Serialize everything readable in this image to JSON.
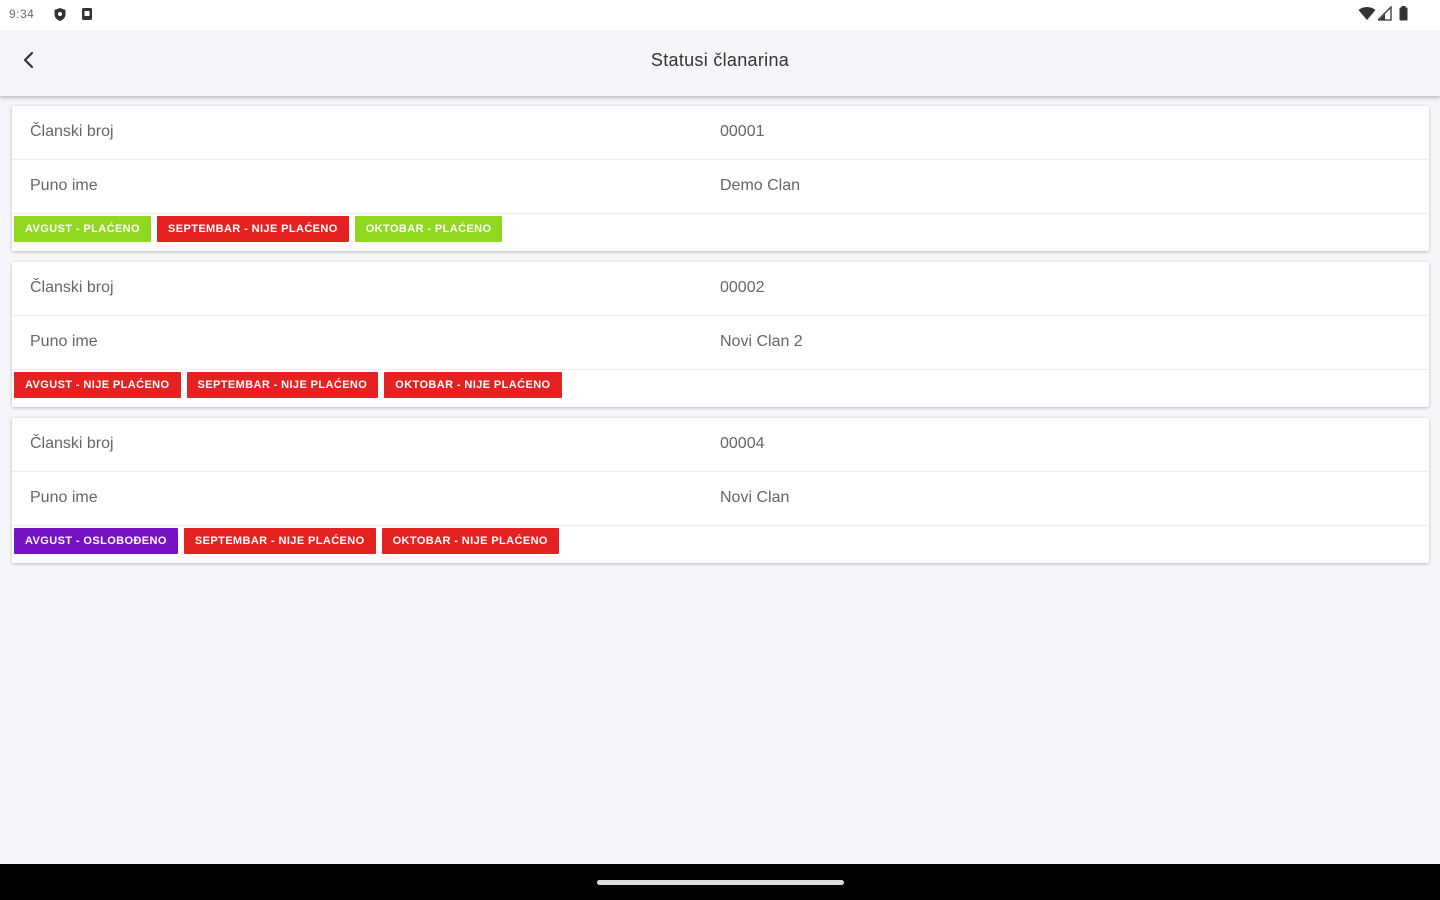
{
  "status_bar": {
    "time": "9:34"
  },
  "app_bar": {
    "title": "Statusi članarina"
  },
  "members": [
    {
      "number_label": "Članski broj",
      "number_value": "00001",
      "name_label": "Puno ime",
      "name_value": "Demo Clan",
      "statuses": [
        {
          "label": "AVGUST - PLAĆENO",
          "type": "paid"
        },
        {
          "label": "SEPTEMBAR - NIJE PLAĆENO",
          "type": "unpaid"
        },
        {
          "label": "OKTOBAR - PLAĆENO",
          "type": "paid"
        }
      ]
    },
    {
      "number_label": "Članski broj",
      "number_value": "00002",
      "name_label": "Puno ime",
      "name_value": "Novi Clan 2",
      "statuses": [
        {
          "label": "AVGUST - NIJE PLAĆENO",
          "type": "unpaid"
        },
        {
          "label": "SEPTEMBAR - NIJE PLAĆENO",
          "type": "unpaid"
        },
        {
          "label": "OKTOBAR - NIJE PLAĆENO",
          "type": "unpaid"
        }
      ]
    },
    {
      "number_label": "Članski broj",
      "number_value": "00004",
      "name_label": "Puno ime",
      "name_value": "Novi Clan",
      "statuses": [
        {
          "label": "AVGUST - OSLOBOĐENO",
          "type": "exempt"
        },
        {
          "label": "SEPTEMBAR - NIJE PLAĆENO",
          "type": "unpaid"
        },
        {
          "label": "OKTOBAR - NIJE PLAĆENO",
          "type": "unpaid"
        }
      ]
    }
  ],
  "colors": {
    "paid": "#8ed81f",
    "unpaid": "#e52222",
    "exempt": "#7712c4",
    "background": "#f5f6f9"
  },
  "icons": {
    "back": "chevron-left-icon",
    "status_left": [
      "shield-icon",
      "sim-icon"
    ],
    "status_right": [
      "wifi-icon",
      "signal-icon",
      "battery-icon"
    ]
  }
}
